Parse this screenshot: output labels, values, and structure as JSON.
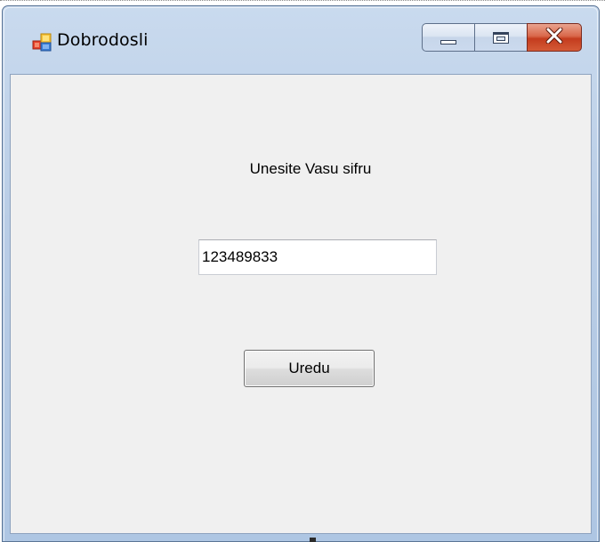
{
  "window": {
    "title": "Dobrodosli",
    "title_icon": "windows-forms-app-icon"
  },
  "caption_buttons": {
    "minimize_icon": "minimize-icon",
    "maximize_icon": "maximize-icon",
    "close_icon": "close-icon",
    "close_color": "#c43c1e"
  },
  "form": {
    "prompt_label": "Unesite Vasu sifru",
    "code_input_value": "123489833",
    "ok_button_label": "Uredu"
  },
  "colors": {
    "titlebar": "#b9cde6",
    "client_background": "#f0f0f0"
  }
}
